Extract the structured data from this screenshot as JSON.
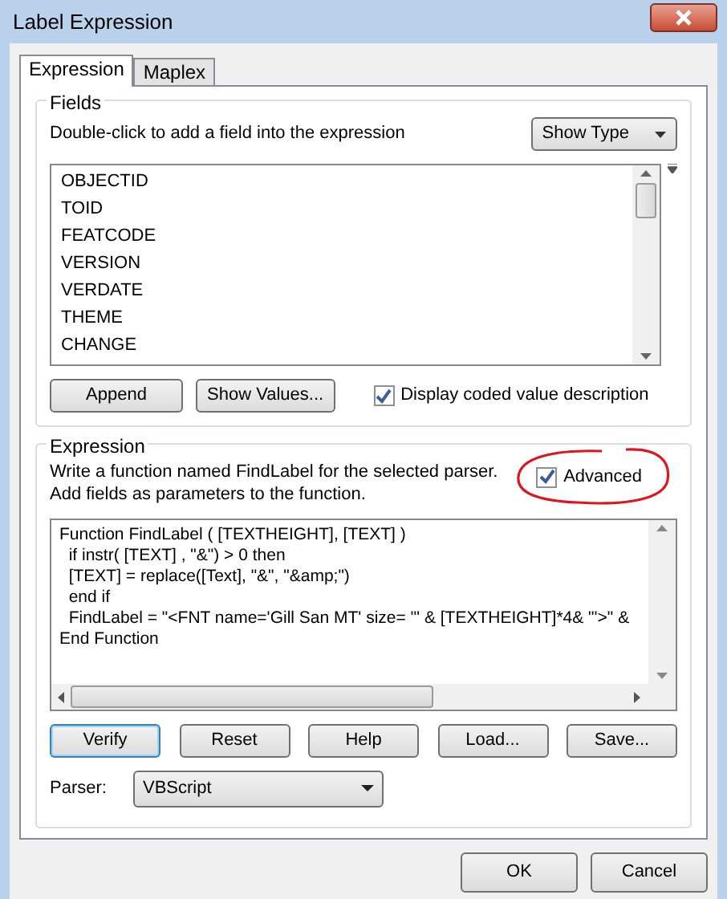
{
  "window": {
    "title": "Label Expression"
  },
  "tabs": [
    {
      "label": "Expression",
      "selected": true
    },
    {
      "label": "Maplex",
      "selected": false
    }
  ],
  "fields": {
    "title": "Fields",
    "hint": "Double-click to add a field into the expression",
    "show_type": "Show Type",
    "items": [
      "OBJECTID",
      "TOID",
      "FEATCODE",
      "VERSION",
      "VERDATE",
      "THEME",
      "CHANGE"
    ],
    "buttons": [
      "Append",
      "Show Values..."
    ],
    "coded_value": {
      "label": "Display coded value description",
      "checked": true
    }
  },
  "expression": {
    "title": "Expression",
    "description": "Write a function named FindLabel for the selected parser. Add fields as parameters to the function.",
    "advanced": {
      "label": "Advanced",
      "checked": true
    },
    "code_lines": [
      "Function FindLabel ( [TEXTHEIGHT], [TEXT] )",
      "  if instr( [TEXT] , \"&\") > 0 then",
      "  [TEXT] = replace([Text], \"&\", \"&amp;\")",
      "  end if",
      "  FindLabel = \"<FNT name='Gill San MT' size= '\" & [TEXTHEIGHT]*4& \"'>\" &",
      "End Function"
    ],
    "buttons": [
      {
        "label": "Verify",
        "focused": true
      },
      {
        "label": "Reset",
        "focused": false
      },
      {
        "label": "Help",
        "focused": false
      },
      {
        "label": "Load...",
        "focused": false
      },
      {
        "label": "Save...",
        "focused": false
      }
    ],
    "parser_label": "Parser:",
    "parser": "VBScript"
  },
  "dialog_buttons": [
    "OK",
    "Cancel"
  ]
}
